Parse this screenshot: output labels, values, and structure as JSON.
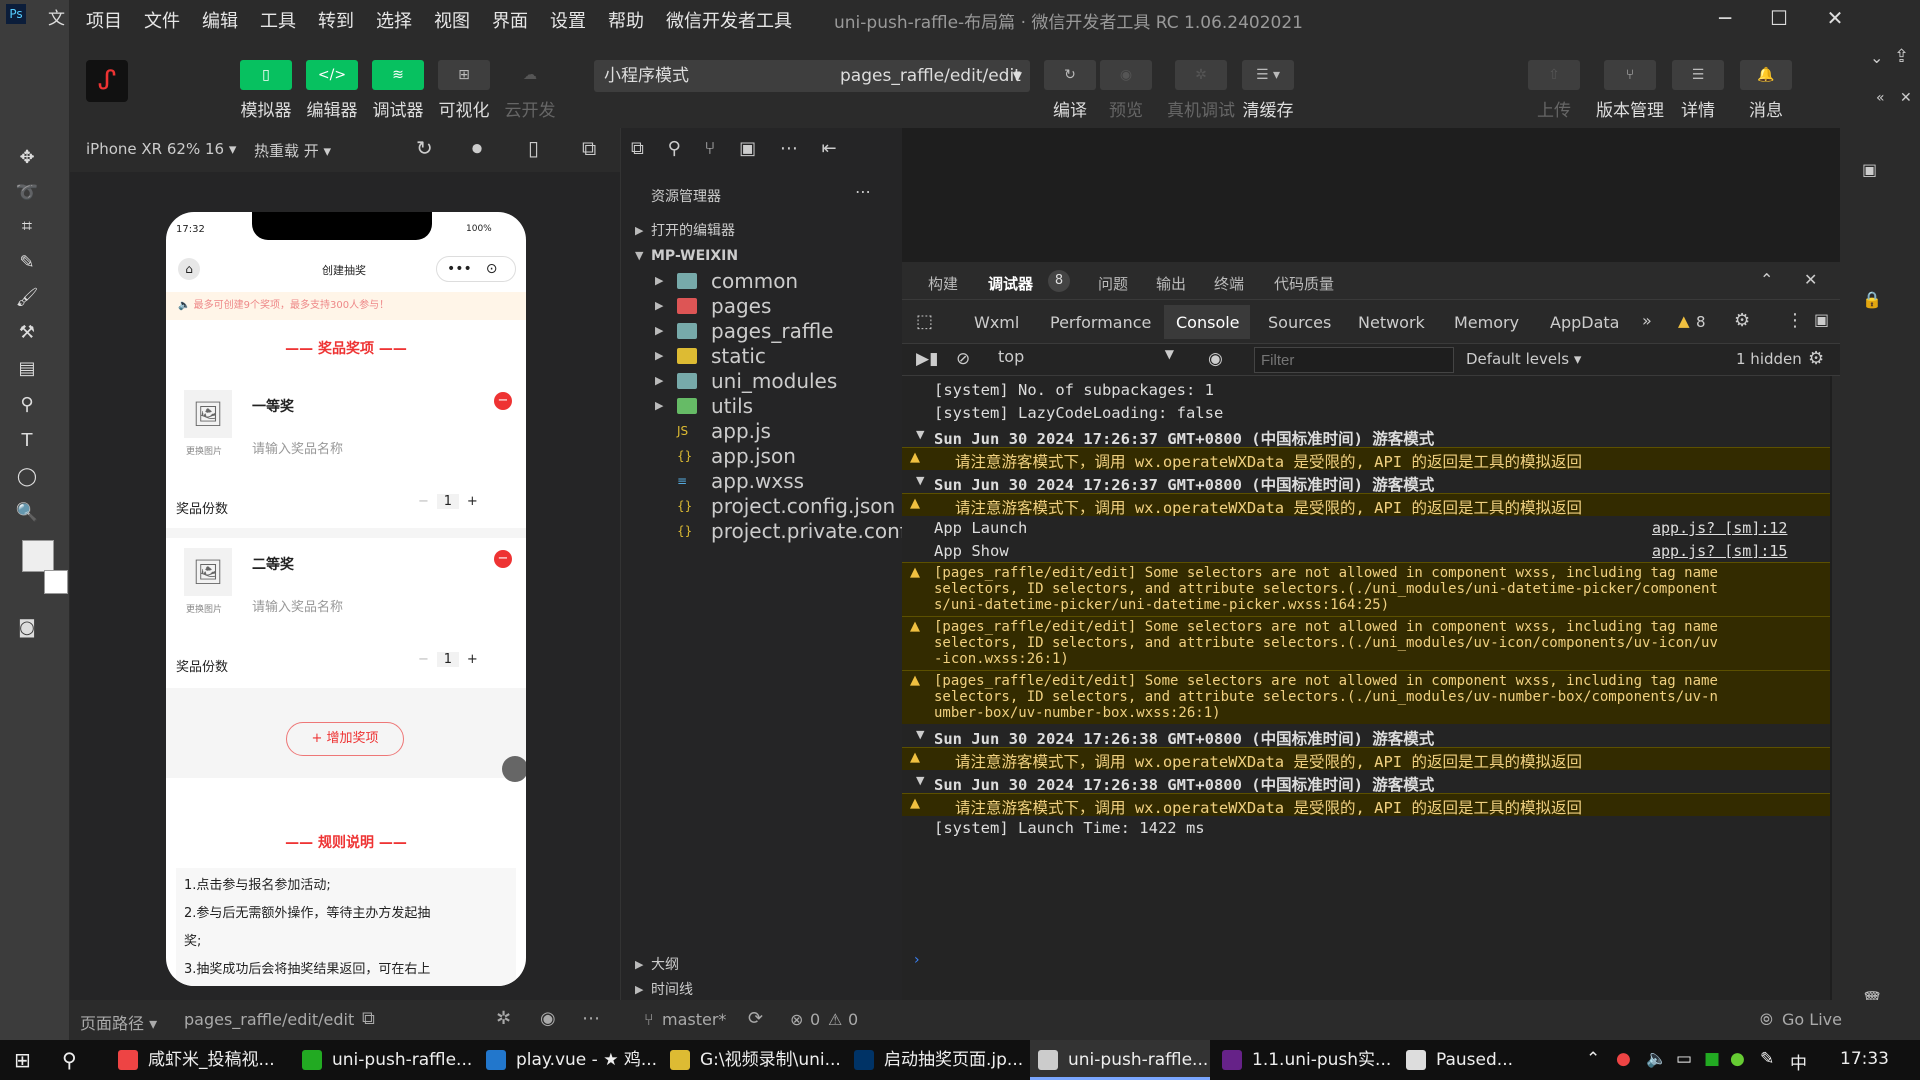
{
  "menu": {
    "items": [
      "项目",
      "文件",
      "编辑",
      "工具",
      "转到",
      "选择",
      "视图",
      "界面",
      "设置",
      "帮助",
      "微信开发者工具"
    ],
    "title": "uni-push-raffle-布局篇 · 微信开发者工具 RC 1.06.2402021",
    "ps_label": "文"
  },
  "toolbar": {
    "simulator": "模拟器",
    "editor": "编辑器",
    "debugger": "调试器",
    "visual": "可视化",
    "cloud": "云开发",
    "mode": "小程序模式",
    "page": "pages_raffle/edit/edit",
    "compile": "编译",
    "preview": "预览",
    "realdebug": "真机调试",
    "clearcache": "清缓存",
    "upload": "上传",
    "version": "版本管理",
    "details": "详情",
    "messages": "消息"
  },
  "simbar": {
    "device": "iPhone XR 62% 16 ▾",
    "hotreload": "热重载 开 ▾"
  },
  "phone": {
    "time": "17:32",
    "battery": "100%",
    "nav_title": "创建抽奖",
    "notice": "最多可创建9个奖项，最多支持300人参与！",
    "prize_section": "奖品奖项",
    "prizes": [
      {
        "name": "一等奖",
        "placeholder": "请输入奖品名称",
        "change_img": "更换图片",
        "count_label": "奖品份数",
        "count": "1"
      },
      {
        "name": "二等奖",
        "placeholder": "请输入奖品名称",
        "change_img": "更换图片",
        "count_label": "奖品份数",
        "count": "1"
      }
    ],
    "add_prize": "+ 增加奖项",
    "rules_section": "规则说明",
    "rules": [
      "1.点击参与报名参加活动;",
      "2.参与后无需额外操作，等待主办方发起抽",
      "奖;",
      "3.抽奖成功后会将抽奖结果返回，可在右上"
    ]
  },
  "statusbar": {
    "path_label": "页面路径 ▾",
    "path": "pages_raffle/edit/edit"
  },
  "explorer": {
    "title": "资源管理器",
    "open_editors": "打开的编辑器",
    "root": "MP-WEIXIN",
    "items": [
      {
        "name": "common",
        "kind": "folder"
      },
      {
        "name": "pages",
        "kind": "folder-red"
      },
      {
        "name": "pages_raffle",
        "kind": "folder"
      },
      {
        "name": "static",
        "kind": "folder-yellow"
      },
      {
        "name": "uni_modules",
        "kind": "folder"
      },
      {
        "name": "utils",
        "kind": "folder-green"
      },
      {
        "name": "app.js",
        "kind": "js"
      },
      {
        "name": "app.json",
        "kind": "json"
      },
      {
        "name": "app.wxss",
        "kind": "wxss"
      },
      {
        "name": "project.config.json",
        "kind": "json"
      },
      {
        "name": "project.private.confi...",
        "kind": "json"
      }
    ],
    "outline": "大纲",
    "timeline": "时间线"
  },
  "devtools": {
    "top_tabs": [
      "构建",
      "调试器",
      "问题",
      "输出",
      "终端",
      "代码质量"
    ],
    "debugger_badge": "8",
    "tabs": [
      "Wxml",
      "Performance",
      "Console",
      "Sources",
      "Network",
      "Memory",
      "AppData"
    ],
    "warn_count": "8",
    "context": "top",
    "filter_placeholder": "Filter",
    "levels": "Default levels ▾",
    "hidden": "1 hidden",
    "logs": [
      {
        "type": "plain",
        "text": "[system] No. of subpackages: 1"
      },
      {
        "type": "plain",
        "text": "[system] LazyCodeLoading: false"
      },
      {
        "type": "group",
        "text": "Sun Jun 30 2024 17:26:37 GMT+0800 (中国标准时间) 游客模式"
      },
      {
        "type": "warn",
        "text": "请注意游客模式下，调用 wx.operateWXData 是受限的, API 的返回是工具的模拟返回"
      },
      {
        "type": "group",
        "text": "Sun Jun 30 2024 17:26:37 GMT+0800 (中国标准时间) 游客模式"
      },
      {
        "type": "warn",
        "text": "请注意游客模式下，调用 wx.operateWXData 是受限的, API 的返回是工具的模拟返回"
      },
      {
        "type": "plain",
        "text": "App Launch",
        "src": "app.js? [sm]:12"
      },
      {
        "type": "plain",
        "text": "App Show",
        "src": "app.js? [sm]:15"
      },
      {
        "type": "warnblock",
        "lines": [
          "[pages_raffle/edit/edit] Some selectors are not allowed in component wxss, including tag name",
          "selectors, ID selectors, and attribute selectors.(./uni_modules/uni-datetime-picker/component",
          "s/uni-datetime-picker/uni-datetime-picker.wxss:164:25)"
        ]
      },
      {
        "type": "warnblock",
        "lines": [
          "[pages_raffle/edit/edit] Some selectors are not allowed in component wxss, including tag name",
          "selectors, ID selectors, and attribute selectors.(./uni_modules/uv-icon/components/uv-icon/uv",
          "-icon.wxss:26:1)"
        ]
      },
      {
        "type": "warnblock",
        "lines": [
          "[pages_raffle/edit/edit] Some selectors are not allowed in component wxss, including tag name",
          "selectors, ID selectors, and attribute selectors.(./uni_modules/uv-number-box/components/uv-n",
          "umber-box/uv-number-box.wxss:26:1)"
        ]
      },
      {
        "type": "group",
        "text": "Sun Jun 30 2024 17:26:38 GMT+0800 (中国标准时间) 游客模式"
      },
      {
        "type": "warn",
        "text": "请注意游客模式下，调用 wx.operateWXData 是受限的, API 的返回是工具的模拟返回"
      },
      {
        "type": "group",
        "text": "Sun Jun 30 2024 17:26:38 GMT+0800 (中国标准时间) 游客模式"
      },
      {
        "type": "warn",
        "text": "请注意游客模式下，调用 wx.operateWXData 是受限的, API 的返回是工具的模拟返回"
      },
      {
        "type": "plain",
        "text": "[system] Launch Time: 1422 ms"
      }
    ]
  },
  "bottombar": {
    "branch": "master*",
    "errors": "0",
    "warnings": "0",
    "golive": "Go Live"
  },
  "taskbar": {
    "items": [
      {
        "label": "咸虾米_投稿视...",
        "color": "#e44"
      },
      {
        "label": "uni-push-raffle...",
        "color": "#2a2"
      },
      {
        "label": "play.vue - ★ 鸡...",
        "color": "#27c"
      },
      {
        "label": "G:\\视频录制\\uni...",
        "color": "#db3"
      },
      {
        "label": "启动抽奖页面.jp...",
        "color": "#036"
      },
      {
        "label": "uni-push-raffle...",
        "color": "#ccc"
      },
      {
        "label": "1.1.uni-push实...",
        "color": "#628"
      },
      {
        "label": "Paused...",
        "color": "#ddd"
      }
    ],
    "ime": "中",
    "clock": "17:33"
  }
}
